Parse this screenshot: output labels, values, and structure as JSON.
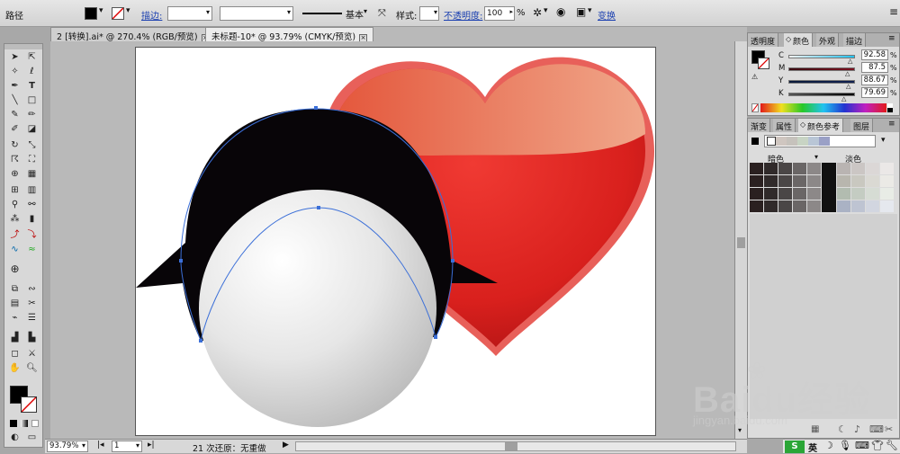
{
  "control_bar": {
    "object_type": "路径",
    "stroke_label": "描边:",
    "stroke_profile": "基本",
    "style_label": "样式:",
    "opacity_label": "不透明度:",
    "opacity_value": "100",
    "opacity_unit": "%",
    "transform_label": "变换",
    "fill_color": "#000000"
  },
  "tabs": [
    {
      "label": "2 [转换].ai* @ 270.4% (RGB/预览)",
      "active": false
    },
    {
      "label": "未标题-10* @ 93.79% (CMYK/预览)",
      "active": true
    }
  ],
  "color_panel": {
    "tabs": [
      "透明度",
      "颜色",
      "外观",
      "描边"
    ],
    "active_tab": "颜色",
    "channels": [
      {
        "label": "C",
        "value": "92.58",
        "percent": 92.58
      },
      {
        "label": "M",
        "value": "87.5",
        "percent": 87.5
      },
      {
        "label": "Y",
        "value": "88.67",
        "percent": 88.67
      },
      {
        "label": "K",
        "value": "79.69",
        "percent": 79.69
      }
    ],
    "unit": "%"
  },
  "guide_panel": {
    "tabs": [
      "渐变",
      "属性",
      "颜色参考",
      "图层"
    ],
    "active_tab": "颜色参考",
    "dark_label": "暗色",
    "light_label": "淡色"
  },
  "status_bar": {
    "zoom": "93.79%",
    "page": "1",
    "status_text": "21 次还原：无重做"
  },
  "watermark": {
    "brand": "Baidu经验",
    "url": "jingyan.baidu.com"
  }
}
